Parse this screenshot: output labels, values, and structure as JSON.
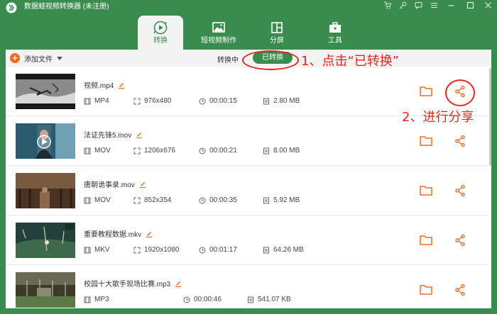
{
  "app": {
    "title": "数据蛙视频转换器 (未注册)"
  },
  "nav": {
    "tabs": [
      {
        "label": "转换",
        "icon": "convert-icon"
      },
      {
        "label": "短视频制作",
        "icon": "image-icon"
      },
      {
        "label": "分屏",
        "icon": "split-screen-icon"
      },
      {
        "label": "工具",
        "icon": "toolbox-icon"
      }
    ]
  },
  "toolbar": {
    "add_file_label": "添加文件",
    "converting_label": "转换中",
    "converted_label": "已转换"
  },
  "files": [
    {
      "name": "视频.mp4",
      "format": "MP4",
      "resolution": "976x480",
      "duration": "00:00:15",
      "size": "2.80 MB"
    },
    {
      "name": "法证先锋5.mov",
      "format": "MOV",
      "resolution": "1206x676",
      "duration": "00:00:21",
      "size": "8.00 MB"
    },
    {
      "name": "唐朝诡事录.mov",
      "format": "MOV",
      "resolution": "852x354",
      "duration": "00:00:35",
      "size": "5.92 MB"
    },
    {
      "name": "重要教程数据.mkv",
      "format": "MKV",
      "resolution": "1920x1080",
      "duration": "00:01:17",
      "size": "64.26 MB"
    },
    {
      "name": "校园十大歌手现场比赛.mp3",
      "format": "MP3",
      "resolution": "",
      "duration": "00:00:46",
      "size": "541.07 KB"
    }
  ],
  "annotations": {
    "step1": "1、点击“已转换”",
    "step2": "2、进行分享"
  },
  "colors": {
    "brand_green": "#3a8c4e",
    "accent_orange": "#f26b21",
    "annotation_red": "#e5271e"
  }
}
